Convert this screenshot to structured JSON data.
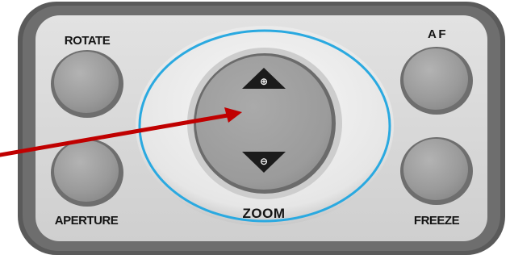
{
  "panel": {
    "colors": {
      "frame": "#5a5a5a",
      "panel_face": "#d8d8d8",
      "button_face": "#9c9c9c",
      "ring_accent": "#2aa9e0",
      "arrow": "#c00000",
      "label_text": "#141414"
    }
  },
  "buttons": {
    "rotate": {
      "label": "ROTATE",
      "icon": "round-button"
    },
    "aperture": {
      "label": "APERTURE",
      "icon": "round-button"
    },
    "af": {
      "label": "A F",
      "icon": "round-button"
    },
    "freeze": {
      "label": "FREEZE",
      "icon": "round-button"
    }
  },
  "zoom": {
    "label": "ZOOM",
    "in_symbol": "⊕",
    "out_symbol": "⊖",
    "in_icon": "triangle-up-plus-icon",
    "out_icon": "triangle-down-minus-icon"
  },
  "pointer": {
    "icon": "red-arrow-icon"
  }
}
